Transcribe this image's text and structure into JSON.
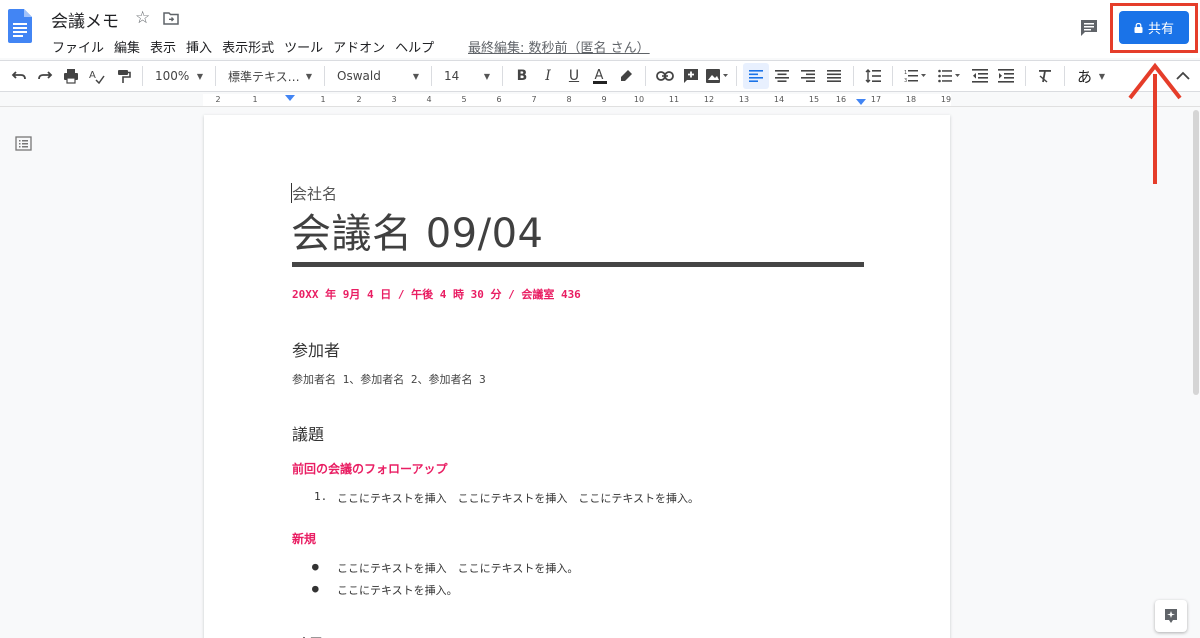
{
  "header": {
    "title": "会議メモ",
    "last_edit": "最終編集: 数秒前（匿名 さん）",
    "share_label": "共有",
    "menu": [
      "ファイル",
      "編集",
      "表示",
      "挿入",
      "表示形式",
      "ツール",
      "アドオン",
      "ヘルプ"
    ]
  },
  "toolbar": {
    "zoom": "100%",
    "style": "標準テキス…",
    "font": "Oswald",
    "size": "14",
    "input_mode": "あ"
  },
  "ruler": {
    "labels": [
      "2",
      "1",
      "1",
      "2",
      "3",
      "4",
      "5",
      "6",
      "7",
      "8",
      "9",
      "10",
      "11",
      "12",
      "13",
      "14",
      "15",
      "16",
      "17",
      "18",
      "19"
    ]
  },
  "doc": {
    "company": "会社名",
    "title": "会議名 09/04",
    "date_line": "20XX 年 9月 4 日 / 午後 4 時 30 分 / 会議室 436",
    "attendees_heading": "参加者",
    "attendees": "参加者名 1、参加者名 2、参加者名 3",
    "agenda_heading": "議題",
    "followup_heading": "前回の会議のフォローアップ",
    "followup_marker": "1.",
    "followup_item": "ここにテキストを挿入　ここにテキストを挿入　ここにテキストを挿入。",
    "new_heading": "新規",
    "new_items": [
      "ここにテキストを挿入　ここにテキストを挿入。",
      "ここにテキストを挿入。"
    ],
    "memo_heading_partial": "メモ"
  },
  "colors": {
    "accent": "#1a73e8",
    "highlight": "#e53d2a",
    "pink": "#e91e63"
  }
}
